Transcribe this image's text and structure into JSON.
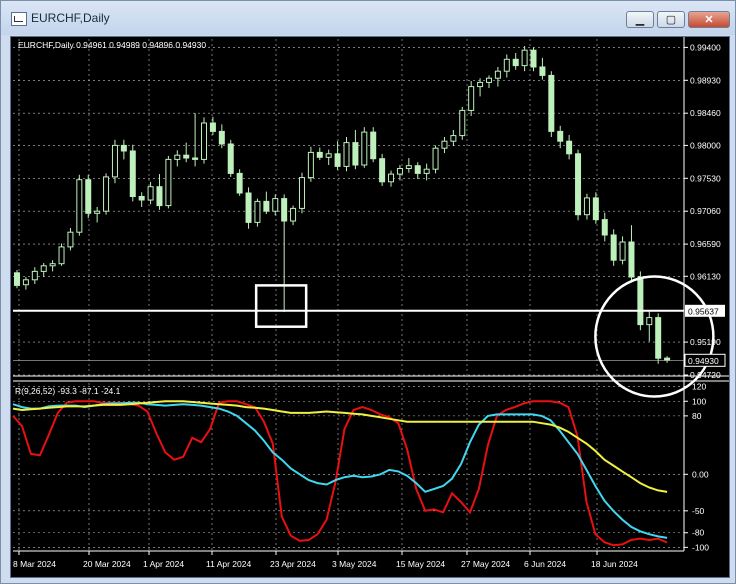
{
  "window": {
    "title": "EURCHF,Daily",
    "minimize_label": "▁",
    "maximize_label": "▢",
    "close_label": "✕"
  },
  "chart_info": "EURCHF,Daily  0.94961 0.94989 0.94896 0.94930",
  "indicator_info": "R(9,26,52) -93.3 -87.1 -24.1",
  "price_labels": [
    "0.99400",
    "0.98930",
    "0.98460",
    "0.98000",
    "0.97530",
    "0.97060",
    "0.96590",
    "0.96130",
    "0.95637",
    "0.95190",
    "0.94930",
    "0.94720"
  ],
  "indicator_labels": [
    "120",
    "100",
    "80",
    "0.00",
    "-50",
    "-80",
    "-100"
  ],
  "date_labels": [
    "8 Mar 2024",
    "20 Mar 2024",
    "1 Apr 2024",
    "11 Apr 2024",
    "23 Apr 2024",
    "3 May 2024",
    "15 May 2024",
    "27 May 2024",
    "6 Jun 2024",
    "18 Jun 2024"
  ],
  "colors": {
    "background": "#000000",
    "grid": "#c0c0c0",
    "candle": "#bef0bc",
    "red_line": "#e81010",
    "cyan_line": "#40d8f0",
    "yellow_line": "#f0f040",
    "annotation": "#ffffff"
  },
  "chart_data": [
    {
      "type": "candlestick",
      "symbol": "EURCHF",
      "timeframe": "Daily",
      "ohlc_current": {
        "open": 0.94961,
        "high": 0.94989,
        "low": 0.94896,
        "close": 0.9493
      },
      "y_ticks": [
        0.994,
        0.9893,
        0.9846,
        0.98,
        0.9753,
        0.9706,
        0.9659,
        0.9613,
        0.9519,
        0.9472
      ],
      "horizontal_line": 0.95637,
      "last_price": 0.9493,
      "ylim": [
        0.9472,
        0.9952
      ],
      "candles": [
        [
          0.9618,
          0.9622,
          0.9596,
          0.96
        ],
        [
          0.9601,
          0.9612,
          0.9594,
          0.9608
        ],
        [
          0.9608,
          0.9626,
          0.9602,
          0.962
        ],
        [
          0.962,
          0.9632,
          0.9612,
          0.9628
        ],
        [
          0.9628,
          0.9636,
          0.962,
          0.9631
        ],
        [
          0.9631,
          0.966,
          0.9628,
          0.9655
        ],
        [
          0.9655,
          0.9682,
          0.965,
          0.9676
        ],
        [
          0.9676,
          0.9758,
          0.9671,
          0.9751
        ],
        [
          0.9751,
          0.9758,
          0.9696,
          0.9703
        ],
        [
          0.9703,
          0.9712,
          0.969,
          0.9706
        ],
        [
          0.9706,
          0.976,
          0.9701,
          0.9755
        ],
        [
          0.9755,
          0.9808,
          0.9746,
          0.98
        ],
        [
          0.98,
          0.9808,
          0.978,
          0.9792
        ],
        [
          0.9792,
          0.9801,
          0.972,
          0.9727
        ],
        [
          0.9727,
          0.9733,
          0.9712,
          0.9722
        ],
        [
          0.9722,
          0.9748,
          0.9716,
          0.9741
        ],
        [
          0.9741,
          0.9759,
          0.9708,
          0.9714
        ],
        [
          0.9714,
          0.9785,
          0.971,
          0.978
        ],
        [
          0.978,
          0.9793,
          0.977,
          0.9786
        ],
        [
          0.9786,
          0.9804,
          0.9776,
          0.9782
        ],
        [
          0.9782,
          0.9846,
          0.977,
          0.978
        ],
        [
          0.978,
          0.984,
          0.9774,
          0.9832
        ],
        [
          0.9832,
          0.9841,
          0.9815,
          0.982
        ],
        [
          0.982,
          0.983,
          0.9796,
          0.9802
        ],
        [
          0.9802,
          0.9808,
          0.9755,
          0.976
        ],
        [
          0.976,
          0.9766,
          0.9728,
          0.9732
        ],
        [
          0.9732,
          0.974,
          0.9681,
          0.969
        ],
        [
          0.969,
          0.9724,
          0.9684,
          0.972
        ],
        [
          0.972,
          0.9734,
          0.9702,
          0.9706
        ],
        [
          0.9706,
          0.973,
          0.97,
          0.9724
        ],
        [
          0.9724,
          0.973,
          0.9562,
          0.9692
        ],
        [
          0.9692,
          0.9714,
          0.9686,
          0.971
        ],
        [
          0.971,
          0.9761,
          0.9703,
          0.9754
        ],
        [
          0.9754,
          0.9798,
          0.9748,
          0.979
        ],
        [
          0.979,
          0.9797,
          0.9779,
          0.9783
        ],
        [
          0.9783,
          0.9794,
          0.9772,
          0.9788
        ],
        [
          0.9788,
          0.9806,
          0.9765,
          0.977
        ],
        [
          0.977,
          0.9812,
          0.9763,
          0.9804
        ],
        [
          0.9804,
          0.9822,
          0.9766,
          0.9772
        ],
        [
          0.9772,
          0.9826,
          0.9768,
          0.9819
        ],
        [
          0.9819,
          0.9826,
          0.9776,
          0.9781
        ],
        [
          0.9781,
          0.9788,
          0.9742,
          0.9748
        ],
        [
          0.9748,
          0.9764,
          0.9741,
          0.9759
        ],
        [
          0.9759,
          0.9772,
          0.975,
          0.9767
        ],
        [
          0.9767,
          0.9782,
          0.9761,
          0.9771
        ],
        [
          0.9771,
          0.9776,
          0.9752,
          0.976
        ],
        [
          0.976,
          0.9774,
          0.975,
          0.9766
        ],
        [
          0.9766,
          0.98,
          0.976,
          0.9796
        ],
        [
          0.9796,
          0.9812,
          0.9789,
          0.9806
        ],
        [
          0.9806,
          0.9822,
          0.9799,
          0.9814
        ],
        [
          0.9814,
          0.9855,
          0.9808,
          0.985
        ],
        [
          0.985,
          0.9892,
          0.9842,
          0.9884
        ],
        [
          0.9884,
          0.9896,
          0.987,
          0.989
        ],
        [
          0.989,
          0.99,
          0.9882,
          0.9896
        ],
        [
          0.9896,
          0.9912,
          0.9884,
          0.9906
        ],
        [
          0.9906,
          0.993,
          0.9897,
          0.9923
        ],
        [
          0.9923,
          0.9932,
          0.9908,
          0.9914
        ],
        [
          0.9914,
          0.9942,
          0.9906,
          0.9936
        ],
        [
          0.9936,
          0.994,
          0.9906,
          0.9912
        ],
        [
          0.9912,
          0.9925,
          0.9894,
          0.99
        ],
        [
          0.99,
          0.9906,
          0.9812,
          0.982
        ],
        [
          0.982,
          0.9828,
          0.9796,
          0.9806
        ],
        [
          0.9806,
          0.9815,
          0.978,
          0.9788
        ],
        [
          0.9788,
          0.9794,
          0.9693,
          0.9701
        ],
        [
          0.9701,
          0.9731,
          0.9694,
          0.9725
        ],
        [
          0.9725,
          0.9733,
          0.9688,
          0.9694
        ],
        [
          0.9694,
          0.9704,
          0.9663,
          0.9672
        ],
        [
          0.9672,
          0.968,
          0.9628,
          0.9636
        ],
        [
          0.9636,
          0.967,
          0.963,
          0.9662
        ],
        [
          0.9662,
          0.9686,
          0.9606,
          0.9612
        ],
        [
          0.9612,
          0.962,
          0.9536,
          0.9544
        ],
        [
          0.9544,
          0.9563,
          0.952,
          0.9554
        ],
        [
          0.9554,
          0.956,
          0.9488,
          0.9496
        ],
        [
          0.94961,
          0.94989,
          0.94896,
          0.9493
        ]
      ]
    },
    {
      "type": "line",
      "label": "R(9,26,52)",
      "y_ticks": [
        120,
        100,
        80,
        0,
        -50,
        -80,
        -100
      ],
      "ylim": [
        -105,
        125
      ],
      "latest_values": [
        -93.3,
        -87.1,
        -24.1
      ],
      "series": [
        {
          "color": "#e81010",
          "values": [
            80,
            66,
            28,
            26,
            54,
            84,
            98,
            100,
            100,
            100,
            98,
            98,
            98,
            96,
            94,
            86,
            56,
            30,
            20,
            24,
            50,
            44,
            62,
            98,
            100,
            100,
            96,
            92,
            72,
            42,
            -58,
            -84,
            -91,
            -90,
            -82,
            -62,
            -10,
            62,
            88,
            92,
            88,
            82,
            78,
            70,
            34,
            -20,
            -50,
            -48,
            -52,
            -26,
            -38,
            -52,
            -20,
            40,
            80,
            88,
            92,
            97,
            100,
            100,
            100,
            98,
            92,
            52,
            -38,
            -82,
            -93,
            -97,
            -96,
            -90,
            -88,
            -90,
            -88,
            -93.3
          ]
        },
        {
          "color": "#40d8f0",
          "values": [
            96,
            92,
            90,
            90,
            93,
            94,
            94,
            94,
            92,
            94,
            96,
            97,
            97,
            98,
            98,
            96,
            95,
            94,
            95,
            96,
            95,
            94,
            92,
            90,
            86,
            80,
            70,
            60,
            46,
            30,
            20,
            8,
            0,
            -8,
            -12,
            -14,
            -8,
            -4,
            -2,
            -4,
            -3,
            0,
            6,
            4,
            -2,
            -12,
            -24,
            -20,
            -16,
            -6,
            14,
            44,
            68,
            80,
            82,
            82,
            82,
            82,
            82,
            80,
            74,
            60,
            44,
            28,
            6,
            -16,
            -36,
            -50,
            -62,
            -72,
            -78,
            -82,
            -85,
            -87.1
          ]
        },
        {
          "color": "#f0f040",
          "values": [
            90,
            88,
            89,
            90,
            91,
            92,
            93,
            93,
            93,
            94,
            95,
            95,
            95,
            96,
            97,
            98,
            99,
            100,
            100,
            100,
            99,
            98,
            97,
            96,
            95,
            94,
            92,
            91,
            90,
            88,
            86,
            84,
            84,
            84,
            85,
            86,
            85,
            84,
            83,
            82,
            80,
            78,
            76,
            74,
            72,
            72,
            72,
            72,
            72,
            72,
            72,
            72,
            72,
            72,
            72,
            72,
            72,
            72,
            72,
            70,
            68,
            64,
            58,
            50,
            42,
            32,
            20,
            12,
            4,
            -4,
            -12,
            -18,
            -22,
            -24.1
          ]
        }
      ]
    }
  ]
}
